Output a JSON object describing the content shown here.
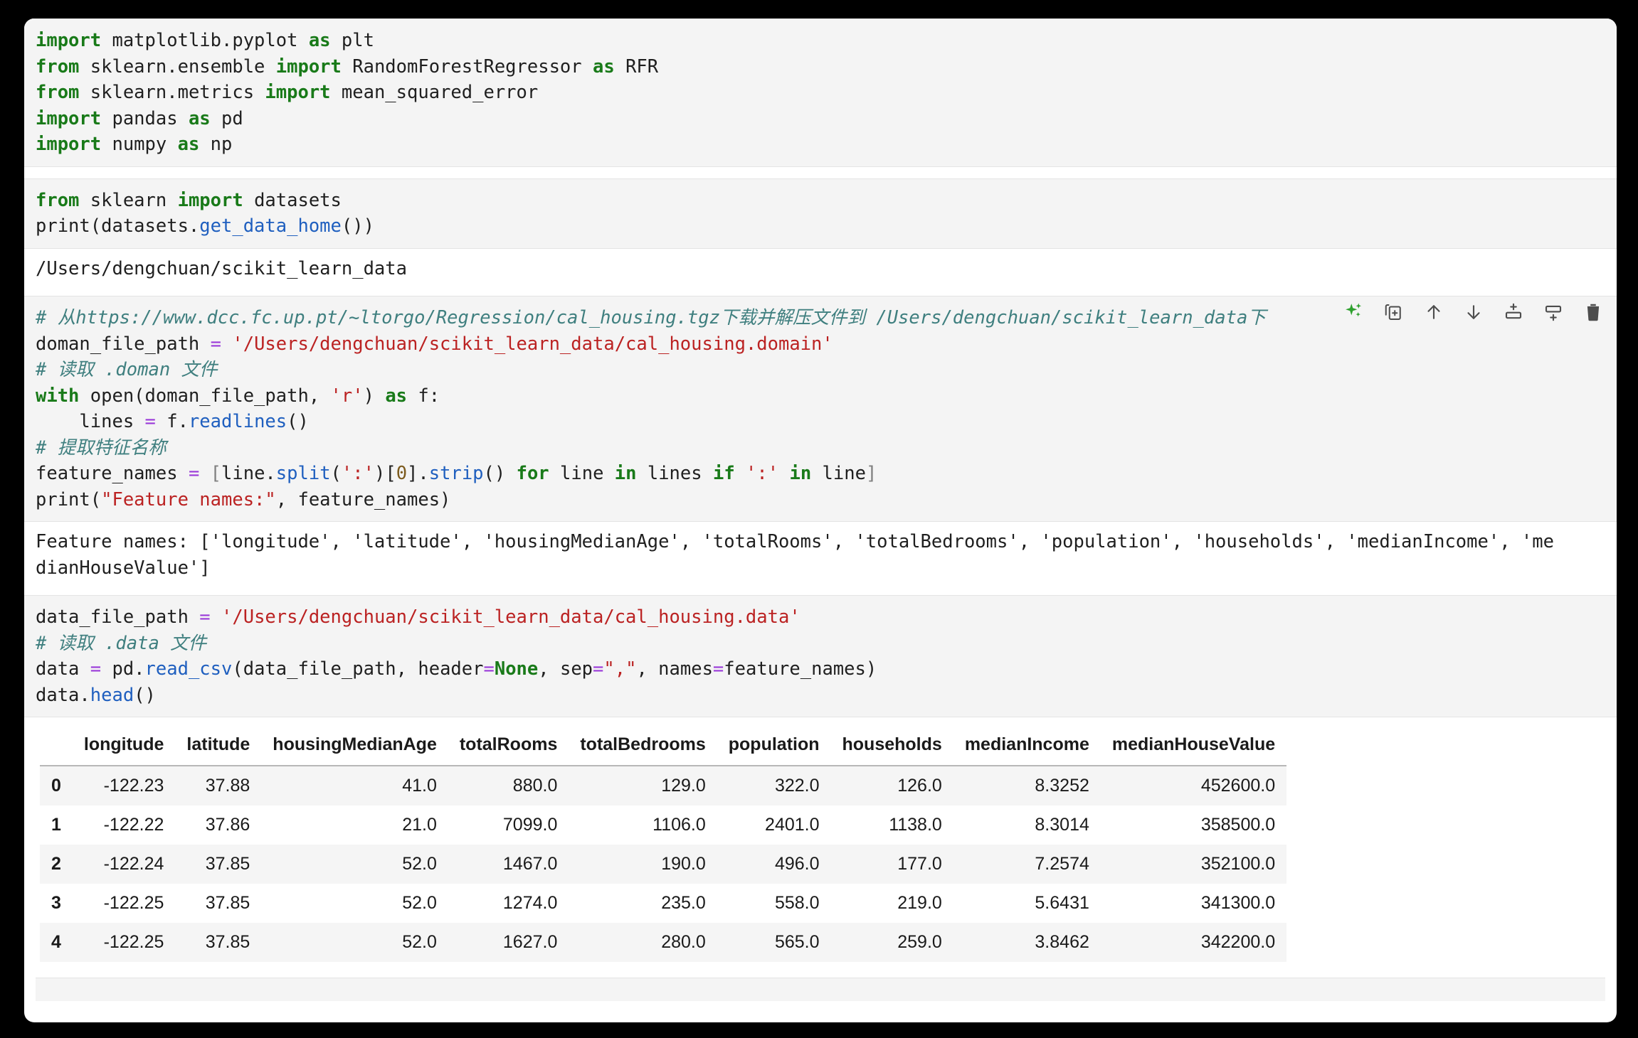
{
  "page": {
    "background": "#000000",
    "surface": "#ffffff",
    "code_background": "#f4f4f4",
    "accent_keyword": "#197a19",
    "accent_string": "#bb2222",
    "accent_comment": "#3f7f7f",
    "accent_function": "#1f5fbf",
    "accent_sparkle": "#2ea02e"
  },
  "cells": [
    {
      "id": "cell-imports",
      "type": "code",
      "lines": [
        [
          {
            "t": "import",
            "c": "k"
          },
          {
            "t": " matplotlib.pyplot ",
            "c": ""
          },
          {
            "t": "as",
            "c": "k"
          },
          {
            "t": " plt",
            "c": ""
          }
        ],
        [
          {
            "t": "from",
            "c": "k"
          },
          {
            "t": " sklearn.ensemble ",
            "c": ""
          },
          {
            "t": "import",
            "c": "k"
          },
          {
            "t": " RandomForestRegressor ",
            "c": ""
          },
          {
            "t": "as",
            "c": "k"
          },
          {
            "t": " RFR",
            "c": ""
          }
        ],
        [
          {
            "t": "from",
            "c": "k"
          },
          {
            "t": " sklearn.metrics ",
            "c": ""
          },
          {
            "t": "import",
            "c": "k"
          },
          {
            "t": " mean_squared_error",
            "c": ""
          }
        ],
        [
          {
            "t": "import",
            "c": "k"
          },
          {
            "t": " pandas ",
            "c": ""
          },
          {
            "t": "as",
            "c": "k"
          },
          {
            "t": " pd",
            "c": ""
          }
        ],
        [
          {
            "t": "import",
            "c": "k"
          },
          {
            "t": " numpy ",
            "c": ""
          },
          {
            "t": "as",
            "c": "k"
          },
          {
            "t": " np",
            "c": ""
          }
        ]
      ]
    },
    {
      "id": "cell-get-data-home",
      "type": "code",
      "lines": [
        [
          {
            "t": "from",
            "c": "k"
          },
          {
            "t": " sklearn ",
            "c": ""
          },
          {
            "t": "import",
            "c": "k"
          },
          {
            "t": " datasets",
            "c": ""
          }
        ],
        [
          {
            "t": "print(datasets.",
            "c": ""
          },
          {
            "t": "get_data_home",
            "c": "fn"
          },
          {
            "t": "())",
            "c": ""
          }
        ]
      ],
      "output": [
        [
          {
            "t": "/Users/dengchuan/scikit_learn_data",
            "c": ""
          }
        ]
      ]
    },
    {
      "id": "cell-feature-names",
      "type": "code",
      "selected": true,
      "toolbar": [
        {
          "name": "ai-sparkles-icon",
          "label": "AI assist"
        },
        {
          "name": "duplicate-cell-icon",
          "label": "Duplicate cell"
        },
        {
          "name": "move-cell-up-icon",
          "label": "Move cell up"
        },
        {
          "name": "move-cell-down-icon",
          "label": "Move cell down"
        },
        {
          "name": "insert-cell-above-icon",
          "label": "Insert cell above"
        },
        {
          "name": "insert-cell-below-icon",
          "label": "Insert cell below"
        },
        {
          "name": "delete-cell-icon",
          "label": "Delete cell"
        }
      ],
      "lines": [
        [
          {
            "t": "# 从https://www.dcc.fc.up.pt/~ltorgo/Regression/cal_housing.tgz下载并解压文件到 /Users/dengchuan/scikit_learn_data下",
            "c": "c"
          }
        ],
        [
          {
            "t": "doman_file_path ",
            "c": ""
          },
          {
            "t": "=",
            "c": "op"
          },
          {
            "t": " ",
            "c": ""
          },
          {
            "t": "'/Users/dengchuan/scikit_learn_data/cal_housing.domain'",
            "c": "s"
          }
        ],
        [
          {
            "t": "# 读取 .doman 文件",
            "c": "c"
          }
        ],
        [
          {
            "t": "with",
            "c": "k"
          },
          {
            "t": " open(doman_file_path, ",
            "c": ""
          },
          {
            "t": "'r'",
            "c": "s"
          },
          {
            "t": ") ",
            "c": ""
          },
          {
            "t": "as",
            "c": "k"
          },
          {
            "t": " f:",
            "c": ""
          }
        ],
        [
          {
            "t": "    lines ",
            "c": ""
          },
          {
            "t": "=",
            "c": "op"
          },
          {
            "t": " f.",
            "c": ""
          },
          {
            "t": "readlines",
            "c": "fn"
          },
          {
            "t": "()",
            "c": ""
          }
        ],
        [
          {
            "t": "# 提取特征名称",
            "c": "c"
          }
        ],
        [
          {
            "t": "feature_names ",
            "c": ""
          },
          {
            "t": "=",
            "c": "op"
          },
          {
            "t": " ",
            "c": ""
          },
          {
            "t": "[",
            "c": "br"
          },
          {
            "t": "line.",
            "c": ""
          },
          {
            "t": "split",
            "c": "fn"
          },
          {
            "t": "(",
            "c": ""
          },
          {
            "t": "':'",
            "c": "s"
          },
          {
            "t": ")[",
            "c": ""
          },
          {
            "t": "0",
            "c": "num"
          },
          {
            "t": "].",
            "c": ""
          },
          {
            "t": "strip",
            "c": "fn"
          },
          {
            "t": "() ",
            "c": ""
          },
          {
            "t": "for",
            "c": "k"
          },
          {
            "t": " line ",
            "c": ""
          },
          {
            "t": "in",
            "c": "k"
          },
          {
            "t": " lines ",
            "c": ""
          },
          {
            "t": "if",
            "c": "k"
          },
          {
            "t": " ",
            "c": ""
          },
          {
            "t": "':'",
            "c": "s"
          },
          {
            "t": " ",
            "c": ""
          },
          {
            "t": "in",
            "c": "k"
          },
          {
            "t": " line",
            "c": ""
          },
          {
            "t": "]",
            "c": "br"
          }
        ],
        [
          {
            "t": "print(",
            "c": ""
          },
          {
            "t": "\"Feature names:\"",
            "c": "s"
          },
          {
            "t": ", feature_names)",
            "c": ""
          }
        ]
      ],
      "output": [
        [
          {
            "t": "Feature names: ['longitude', 'latitude', 'housingMedianAge', 'totalRooms', 'totalBedrooms', 'population', 'households', 'medianIncome', 'me",
            "c": ""
          }
        ],
        [
          {
            "t": "dianHouseValue']",
            "c": ""
          }
        ]
      ]
    },
    {
      "id": "cell-read-csv",
      "type": "code",
      "lines": [
        [
          {
            "t": "data_file_path ",
            "c": ""
          },
          {
            "t": "=",
            "c": "op"
          },
          {
            "t": " ",
            "c": ""
          },
          {
            "t": "'/Users/dengchuan/scikit_learn_data/cal_housing.data'",
            "c": "s"
          }
        ],
        [
          {
            "t": "# 读取 .data 文件",
            "c": "c"
          }
        ],
        [
          {
            "t": "data ",
            "c": ""
          },
          {
            "t": "=",
            "c": "op"
          },
          {
            "t": " pd.",
            "c": ""
          },
          {
            "t": "read_csv",
            "c": "fn"
          },
          {
            "t": "(data_file_path, header",
            "c": ""
          },
          {
            "t": "=",
            "c": "op"
          },
          {
            "t": "None",
            "c": "kn"
          },
          {
            "t": ", sep",
            "c": ""
          },
          {
            "t": "=",
            "c": "op"
          },
          {
            "t": "\",\"",
            "c": "s"
          },
          {
            "t": ", names",
            "c": ""
          },
          {
            "t": "=",
            "c": "op"
          },
          {
            "t": "feature_names)",
            "c": ""
          }
        ],
        [
          {
            "t": "data.",
            "c": ""
          },
          {
            "t": "head",
            "c": "fn"
          },
          {
            "t": "()",
            "c": ""
          }
        ]
      ]
    }
  ],
  "dataframe": {
    "index_header": "",
    "columns": [
      "longitude",
      "latitude",
      "housingMedianAge",
      "totalRooms",
      "totalBedrooms",
      "population",
      "households",
      "medianIncome",
      "medianHouseValue"
    ],
    "index": [
      "0",
      "1",
      "2",
      "3",
      "4"
    ],
    "rows": [
      [
        "-122.23",
        "37.88",
        "41.0",
        "880.0",
        "129.0",
        "322.0",
        "126.0",
        "8.3252",
        "452600.0"
      ],
      [
        "-122.22",
        "37.86",
        "21.0",
        "7099.0",
        "1106.0",
        "2401.0",
        "1138.0",
        "8.3014",
        "358500.0"
      ],
      [
        "-122.24",
        "37.85",
        "52.0",
        "1467.0",
        "190.0",
        "496.0",
        "177.0",
        "7.2574",
        "352100.0"
      ],
      [
        "-122.25",
        "37.85",
        "52.0",
        "1274.0",
        "235.0",
        "558.0",
        "219.0",
        "5.6431",
        "341300.0"
      ],
      [
        "-122.25",
        "37.85",
        "52.0",
        "1627.0",
        "280.0",
        "565.0",
        "259.0",
        "3.8462",
        "342200.0"
      ]
    ]
  }
}
